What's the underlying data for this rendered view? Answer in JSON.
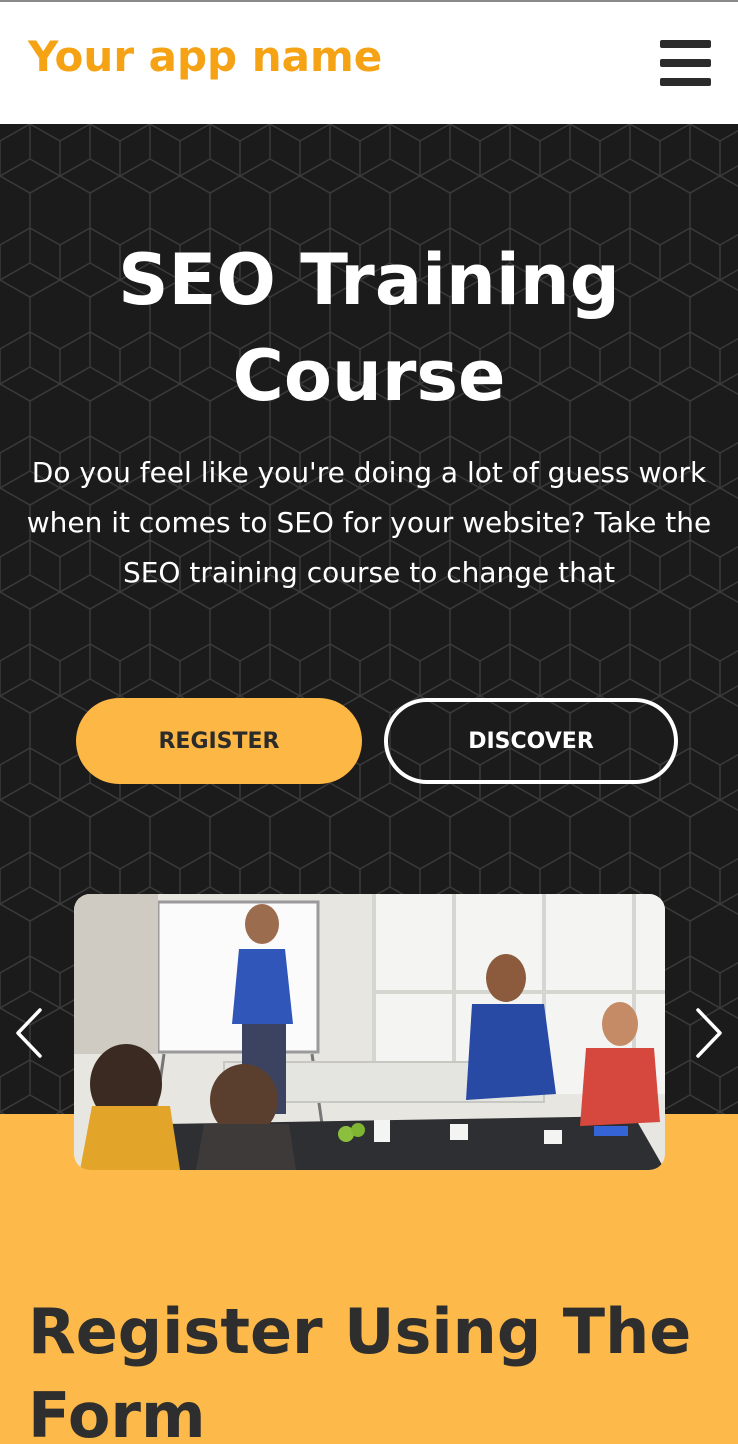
{
  "header": {
    "app_name": "Your app name",
    "menu_icon": "hamburger-menu-icon"
  },
  "hero": {
    "title": "SEO Training Course",
    "description": "Do you feel like you're doing a lot of guess work when it comes to SEO for your website? Take the SEO training course to change that",
    "register_label": "REGISTER",
    "discover_label": "DISCOVER"
  },
  "carousel": {
    "prev_icon": "chevron-left-icon",
    "next_icon": "chevron-right-icon"
  },
  "register_section": {
    "heading": "Register Using The Form"
  },
  "colors": {
    "brand": "#f5a314",
    "accent": "#fdb744",
    "hero_bg": "#1a1a1a",
    "section_bg": "#fdb94a"
  }
}
